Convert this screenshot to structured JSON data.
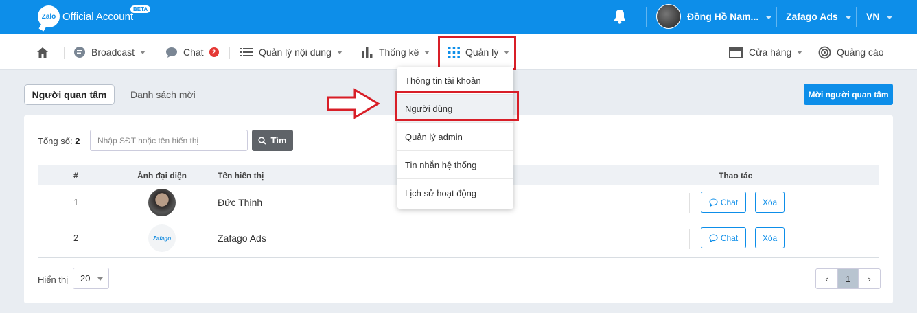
{
  "topbar": {
    "logo_icon_text": "Zalo",
    "logo_text": "Official Account",
    "beta": "BETA",
    "user_name": "Đồng Hồ Nam...",
    "account": "Zafago Ads",
    "language": "VN"
  },
  "nav": {
    "broadcast": "Broadcast",
    "chat": "Chat",
    "chat_badge": "2",
    "content": "Quản lý nội dung",
    "stats": "Thống kê",
    "manage": "Quản lý",
    "store": "Cửa hàng",
    "ads": "Quảng cáo"
  },
  "tabs": {
    "active": "Người quan tâm",
    "inactive": "Danh sách mời"
  },
  "invite_button": "Mời người quan tâm",
  "filter": {
    "total_label": "Tổng số:",
    "total_value": "2",
    "search_placeholder": "Nhập SĐT hoặc tên hiển thị",
    "search_button": "Tìm"
  },
  "table": {
    "headers": [
      "#",
      "Ảnh đại diện",
      "Tên hiển thị",
      "Thao tác"
    ],
    "rows": [
      {
        "index": "1",
        "name": "Đức Thịnh",
        "avatar_text": ""
      },
      {
        "index": "2",
        "name": "Zafago Ads",
        "avatar_text": "Zafago"
      }
    ],
    "chat_label": "Chat",
    "delete_label": "Xóa"
  },
  "footer": {
    "show_label": "Hiển thị",
    "page_size": "20",
    "prev": "‹",
    "current_page": "1",
    "next": "›"
  },
  "dropdown": {
    "items": [
      "Thông tin tài khoản",
      "Người dùng",
      "Quản lý admin",
      "Tin nhắn hệ thống",
      "Lịch sử hoạt động"
    ]
  },
  "colors": {
    "brand": "#0d8ee9",
    "highlight_box": "#d81e27",
    "badge": "#e53935"
  }
}
